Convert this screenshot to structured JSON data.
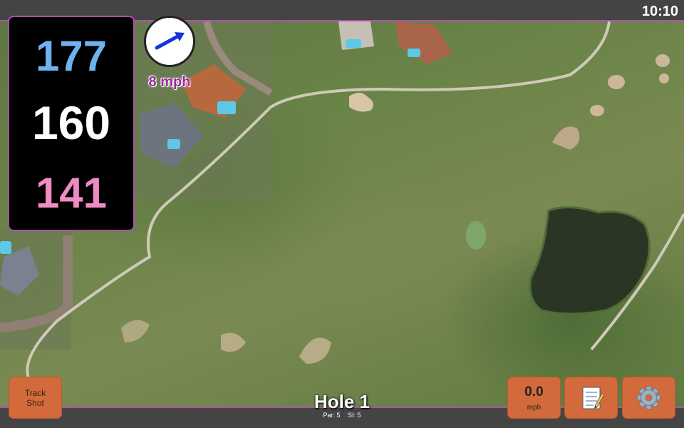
{
  "status_bar": {
    "time": "10:10"
  },
  "distances": {
    "back": "177",
    "middle": "160",
    "front": "141"
  },
  "wind": {
    "speed": "8 mph",
    "direction_icon": "arrow-icon"
  },
  "track_shot": {
    "line1": "Track",
    "line2": "Shot"
  },
  "hole": {
    "title": "Hole 1",
    "par": "Par: 5",
    "stroke_index": "SI: 5"
  },
  "speed": {
    "value": "0.0",
    "unit": "mph"
  },
  "icons": {
    "notes": "notepad-icon",
    "settings": "gear-icon"
  },
  "colors": {
    "back": "#6fb2f0",
    "middle": "#ffffff",
    "front": "#f08bc3",
    "accent": "#b04fb0",
    "button": "#d26a3b",
    "wind_text": "#9b2d9b"
  }
}
